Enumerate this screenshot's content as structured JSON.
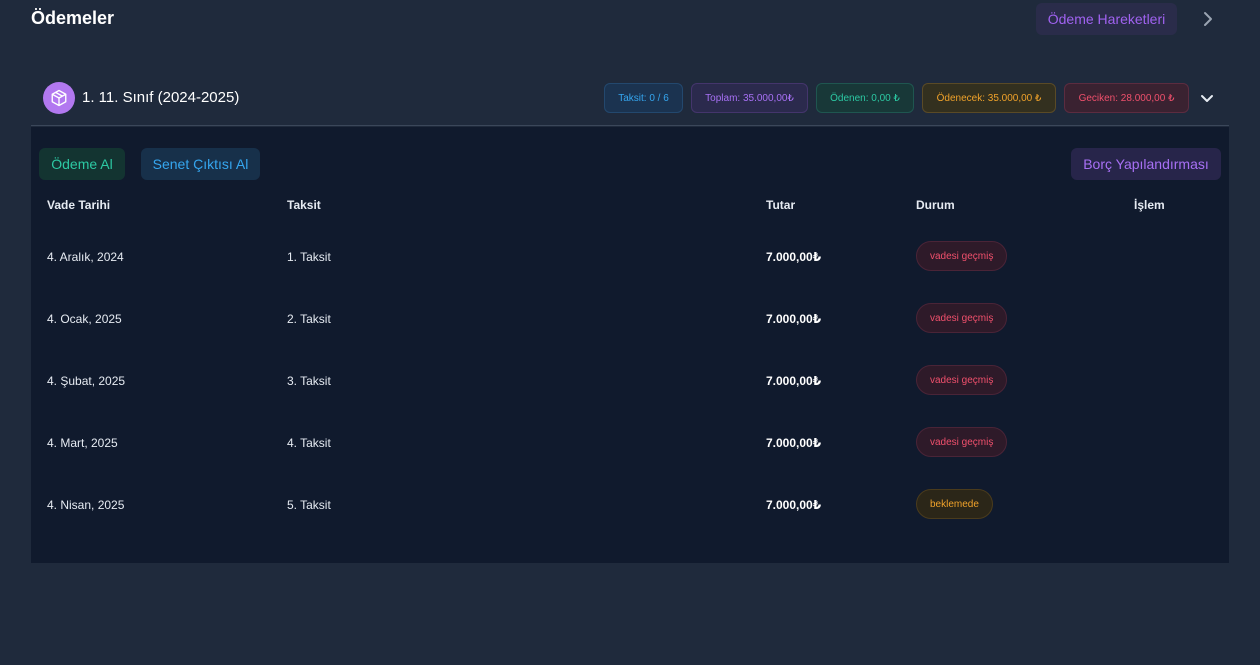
{
  "header": {
    "title": "Ödemeler",
    "history_button": "Ödeme Hareketleri"
  },
  "card": {
    "title": "1. 11. Sınıf (2024-2025)",
    "badges": {
      "taksit": "Taksit: 0 / 6",
      "toplam": "Toplam: 35.000,00₺",
      "odenen": "Ödenen: 0,00 ₺",
      "odenecek": "Ödenecek: 35.000,00 ₺",
      "geciken": "Geciken: 28.000,00 ₺"
    }
  },
  "actions": {
    "pay": "Ödeme Al",
    "senet": "Senet Çıktısı Al",
    "restructure": "Borç Yapılandırması"
  },
  "table": {
    "columns": {
      "due_date": "Vade Tarihi",
      "installment": "Taksit",
      "amount": "Tutar",
      "status": "Durum",
      "action": "İşlem"
    },
    "rows": [
      {
        "due_date": "4. Aralık, 2024",
        "installment": "1. Taksit",
        "amount": "7.000,00₺",
        "status": "vadesi geçmiş",
        "status_type": "overdue"
      },
      {
        "due_date": "4. Ocak, 2025",
        "installment": "2. Taksit",
        "amount": "7.000,00₺",
        "status": "vadesi geçmiş",
        "status_type": "overdue"
      },
      {
        "due_date": "4. Şubat, 2025",
        "installment": "3. Taksit",
        "amount": "7.000,00₺",
        "status": "vadesi geçmiş",
        "status_type": "overdue"
      },
      {
        "due_date": "4. Mart, 2025",
        "installment": "4. Taksit",
        "amount": "7.000,00₺",
        "status": "vadesi geçmiş",
        "status_type": "overdue"
      },
      {
        "due_date": "4. Nisan, 2025",
        "installment": "5. Taksit",
        "amount": "7.000,00₺",
        "status": "beklemede",
        "status_type": "pending"
      }
    ]
  },
  "colors": {
    "background": "#1f2a3c",
    "panel": "#101a2d",
    "purple": "#a770f4",
    "teal": "#2cc9a3",
    "blue": "#35a6ef",
    "orange": "#f0a22a",
    "red": "#f0506c"
  },
  "icons": {
    "header_right": "chevron-right-icon",
    "card_avatar": "package-box-icon",
    "card_toggle": "chevron-down-icon"
  }
}
